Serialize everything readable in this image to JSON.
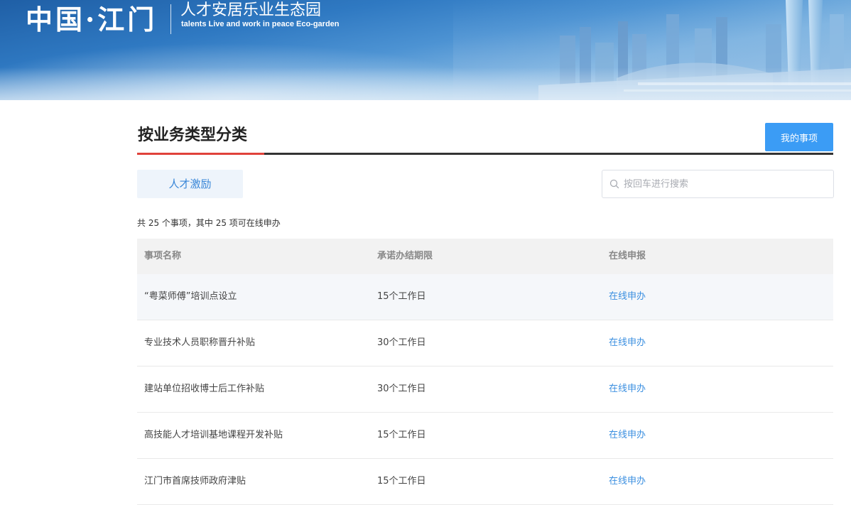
{
  "banner": {
    "logo_text": "中国·江门",
    "title": "人才安居乐业生态园",
    "subtitle": "talents Live and work in peace Eco-garden"
  },
  "section": {
    "title": "按业务类型分类",
    "my_items_label": "我的事项"
  },
  "category": {
    "active_tab": "人才激励"
  },
  "search": {
    "placeholder": "按回车进行搜索",
    "value": ""
  },
  "summary": "共 25 个事项，其中 25 项可在线申办",
  "table": {
    "headers": [
      "事项名称",
      "承诺办结期限",
      "在线申报"
    ],
    "rows": [
      {
        "name": "“粤菜师傅”培训点设立",
        "deadline": "15个工作日",
        "action": "在线申办"
      },
      {
        "name": "专业技术人员职称晋升补贴",
        "deadline": "30个工作日",
        "action": "在线申办"
      },
      {
        "name": "建站单位招收博士后工作补贴",
        "deadline": "30个工作日",
        "action": "在线申办"
      },
      {
        "name": "高技能人才培训基地课程开发补贴",
        "deadline": "15个工作日",
        "action": "在线申办"
      },
      {
        "name": "江门市首席技师政府津贴",
        "deadline": "15个工作日",
        "action": "在线申办"
      }
    ]
  },
  "colors": {
    "accent_blue": "#3b9cf5",
    "link_blue": "#3b8fe0",
    "accent_red": "#e0423b",
    "tab_bg": "#eef4fb"
  },
  "icons": {
    "search": "search-icon"
  }
}
